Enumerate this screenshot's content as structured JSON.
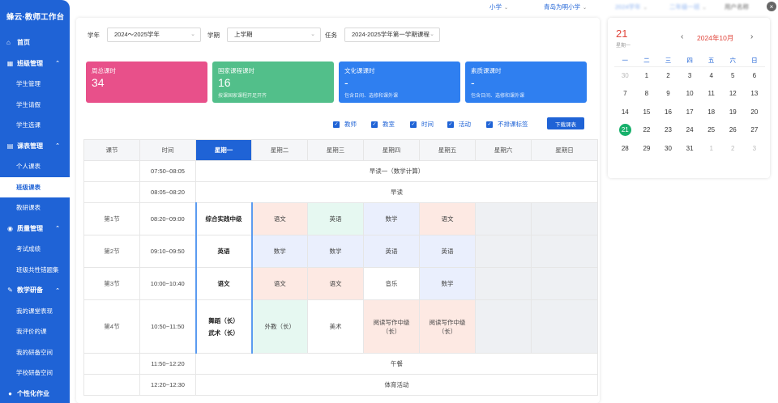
{
  "brand": "蜂云·教师工作台",
  "sidebar": {
    "home": "首页",
    "groups": [
      {
        "label": "班级管理",
        "icon": "class-icon",
        "items": [
          "学生管理",
          "学生请假",
          "学生选课"
        ]
      },
      {
        "label": "课表管理",
        "icon": "timetable-icon",
        "items": [
          "个人课表",
          "班级课表",
          "教研课表"
        ]
      },
      {
        "label": "质量管理",
        "icon": "quality-icon",
        "items": [
          "考试成绩",
          "班级共性错题集"
        ]
      },
      {
        "label": "教学研备",
        "icon": "research-icon",
        "items": [
          "我的课堂表现",
          "我评价的课",
          "我的研备空间",
          "学校研备空间"
        ]
      },
      {
        "label": "个性化作业",
        "icon": "homework-icon",
        "items": []
      }
    ],
    "active_item": "班级课表"
  },
  "topbar": {
    "level": "小学",
    "school": "青岛为明小学",
    "blur1": "2024学年",
    "blur2": "二年级一班",
    "user": "用户名称"
  },
  "filters": {
    "year_label": "学年",
    "year_value": "2024～2025学年",
    "term_label": "学期",
    "term_value": "上学期",
    "task_label": "任务",
    "task_value": "2024-2025学年第一学期课程"
  },
  "cards": [
    {
      "title": "周总课时",
      "value": "34",
      "sub": "",
      "color": "#e8508a"
    },
    {
      "title": "国家课程课时",
      "value": "16",
      "sub": "按课国家课程开足开齐",
      "color": "#52bf8a"
    },
    {
      "title": "文化课课时",
      "value": "-",
      "sub": "包含日间、选修和课外课",
      "color": "#2f7ff0"
    },
    {
      "title": "素质课课时",
      "value": "-",
      "sub": "包含日间、选修和课外课",
      "color": "#2f7ff0"
    }
  ],
  "checks": [
    "教师",
    "教室",
    "时间",
    "活动",
    "不排课标签"
  ],
  "download_label": "下载课表",
  "timetable": {
    "headers": [
      "课节",
      "时间",
      "星期一",
      "星期二",
      "星期三",
      "星期四",
      "星期五",
      "星期六",
      "星期日"
    ],
    "rows": [
      {
        "type": "span",
        "period": "",
        "time": "07:50~08:05",
        "label": "早读一（数学计算）"
      },
      {
        "type": "span",
        "period": "",
        "time": "08:05~08:20",
        "label": "早读"
      },
      {
        "type": "class",
        "period": "第1节",
        "time": "08:20~09:00",
        "mon": [
          "综合实践中级"
        ],
        "cells": [
          [
            "语文",
            "pink"
          ],
          [
            "英语",
            "mint"
          ],
          [
            "数学",
            "lav"
          ],
          [
            "语文",
            "pink"
          ],
          [
            "",
            "grey"
          ],
          [
            "",
            "grey"
          ]
        ]
      },
      {
        "type": "class",
        "period": "第2节",
        "time": "09:10~09:50",
        "mon": [
          "英语"
        ],
        "cells": [
          [
            "数学",
            "lav"
          ],
          [
            "数学",
            "lav"
          ],
          [
            "英语",
            "lav"
          ],
          [
            "英语",
            "lav"
          ],
          [
            "",
            "grey"
          ],
          [
            "",
            "grey"
          ]
        ]
      },
      {
        "type": "class",
        "period": "第3节",
        "time": "10:00~10:40",
        "mon": [
          "语文"
        ],
        "cells": [
          [
            "语文",
            "pink"
          ],
          [
            "语文",
            "pink"
          ],
          [
            "音乐",
            "white"
          ],
          [
            "数学",
            "lav"
          ],
          [
            "",
            "grey"
          ],
          [
            "",
            "grey"
          ]
        ]
      },
      {
        "type": "class",
        "period": "第4节",
        "time": "10:50~11:50",
        "mon": [
          "舞蹈（长）",
          "武术（长）"
        ],
        "cells": [
          [
            "外教（长）",
            "mint"
          ],
          [
            "美术",
            "white"
          ],
          [
            "阅读写作中级（长）",
            "pink"
          ],
          [
            "阅读写作中级（长）",
            "pink"
          ],
          [
            "",
            "grey"
          ],
          [
            "",
            "grey"
          ]
        ]
      },
      {
        "type": "span",
        "period": "",
        "time": "11:50~12:20",
        "label": "午餐"
      },
      {
        "type": "span",
        "period": "",
        "time": "12:20~12:30",
        "label": "体育活动"
      }
    ]
  },
  "calendar": {
    "day": "21",
    "weekday": "星期一",
    "month": "2024年10月",
    "weekday_headers": [
      "一",
      "二",
      "三",
      "四",
      "五",
      "六",
      "日"
    ],
    "weeks": [
      [
        "30",
        "1",
        "2",
        "3",
        "4",
        "5",
        "6"
      ],
      [
        "7",
        "8",
        "9",
        "10",
        "11",
        "12",
        "13"
      ],
      [
        "14",
        "15",
        "16",
        "17",
        "18",
        "19",
        "20"
      ],
      [
        "21",
        "22",
        "23",
        "24",
        "25",
        "26",
        "27"
      ],
      [
        "28",
        "29",
        "30",
        "31",
        "1",
        "2",
        "3"
      ]
    ],
    "today": "21"
  }
}
